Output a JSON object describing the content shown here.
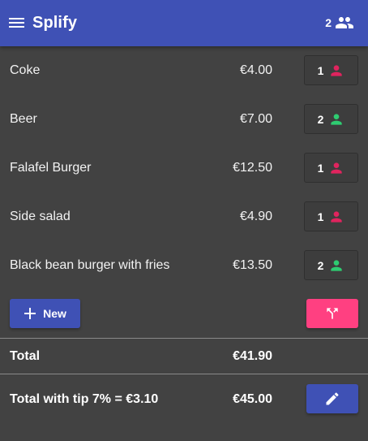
{
  "appbar": {
    "title": "Splify",
    "people_count": "2",
    "color": "#3f51b5"
  },
  "items": [
    {
      "name": "Coke",
      "price": "€4.00",
      "people": "1",
      "status_color": "#e0245e"
    },
    {
      "name": "Beer",
      "price": "€7.00",
      "people": "2",
      "status_color": "#2ecc71"
    },
    {
      "name": "Falafel Burger",
      "price": "€12.50",
      "people": "1",
      "status_color": "#e0245e"
    },
    {
      "name": "Side salad",
      "price": "€4.90",
      "people": "1",
      "status_color": "#e0245e"
    },
    {
      "name": "Black bean burger with fries",
      "price": "€13.50",
      "people": "2",
      "status_color": "#2ecc71"
    }
  ],
  "actions": {
    "new_label": "New",
    "split_color": "#ff4081"
  },
  "totals": {
    "total_label": "Total",
    "total_value": "€41.90",
    "tip_label": "Total with tip 7% = €3.10",
    "tip_value": "€45.00"
  }
}
